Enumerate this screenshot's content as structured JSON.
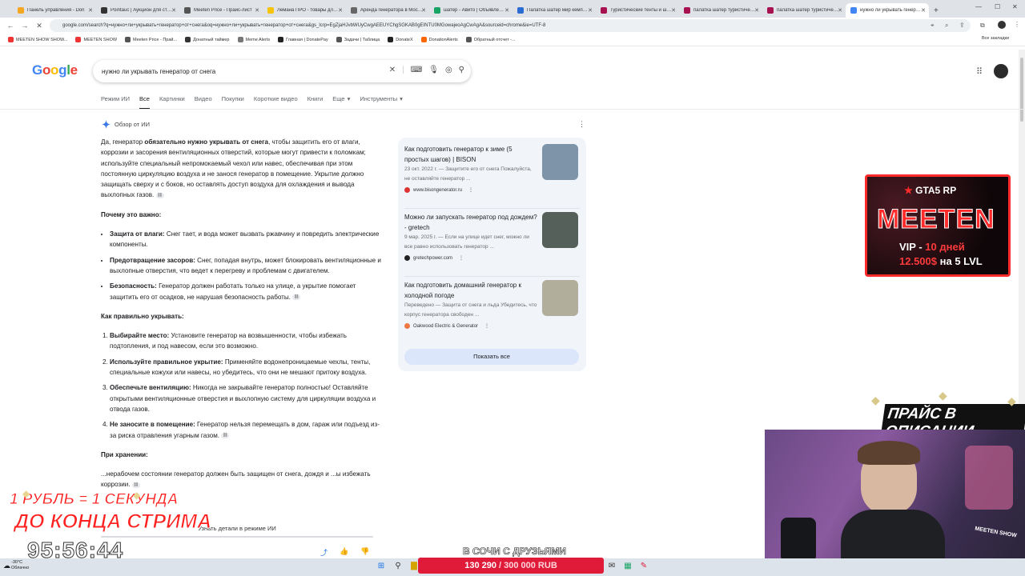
{
  "tabs": [
    {
      "title": "Панель управления - Don",
      "color": "#f5a623"
    },
    {
      "title": "Pointauc | Аукцион для стримеров",
      "color": "#333333"
    },
    {
      "title": "Meeten Price - Прайс-лист",
      "color": "#555555"
    },
    {
      "title": "Лемана ПРО - товары для дома",
      "color": "#f6c20a"
    },
    {
      "title": "Аренда генератора в Москве",
      "color": "#666666"
    },
    {
      "title": "шатер - Авито | Объявления",
      "color": "#19a463"
    },
    {
      "title": "Палатка шатер мир кемпинга",
      "color": "#2b6cd3"
    },
    {
      "title": "Туристические тенты и шатры",
      "color": "#a8114f"
    },
    {
      "title": "палатка шатер туристическая",
      "color": "#a8114f"
    },
    {
      "title": "палатка шатер туристическая",
      "color": "#a8114f"
    },
    {
      "title": "нужно ли укрывать генератор от снега",
      "color": "#4285f4",
      "active": true
    }
  ],
  "url": "google.com/search?q=нужно+ли+укрывать+генератор+от+снега&oq=нужно+ли+укрывать+генератор+от+снега&gs_lcrp=EgZjaHJvbWUyCwgAEEUYChgSGKAB0gEINTU0MGowajeoAgCwAgA&sourceid=chrome&ie=UTF-8",
  "bookmarks": [
    "MEETEN SHOW SHOW...",
    "MEETEN SHOW",
    "Meeten Price - Прай...",
    "Донатный таймер",
    "Meme Alerts",
    "Главная | DonatePay",
    "Задачи | Таблица",
    "DonateX",
    "DonationAlerts",
    "Обратный отсчет -..."
  ],
  "bookmarks_all": "Все закладки",
  "search": {
    "query": "нужно ли укрывать генератор от снега"
  },
  "logo": "Google",
  "search_tabs": [
    "Режим ИИ",
    "Все",
    "Картинки",
    "Видео",
    "Покупки",
    "Короткие видео",
    "Книги",
    "Еще",
    "Инструменты"
  ],
  "ai": {
    "header": "Обзор от ИИ",
    "intro_pre": "Да, генератор ",
    "intro_bold": "обязательно нужно укрывать от снега",
    "intro_post": ", чтобы защитить его от влаги, коррозии и засорения вентиляционных отверстий, которые могут привести к поломкам; используйте специальный непромокаемый чехол или навес, обеспечивая при этом постоянную циркуляцию воздуха и не занося генератор в помещение. Укрытие должно защищать сверху и с боков, но оставлять доступ воздуха для охлаждения и вывода выхлопных газов.",
    "why_title": "Почему это важно:",
    "why": [
      {
        "b": "Защита от влаги:",
        "t": " Снег тает, и вода может вызвать ржавчину и повредить электрические компоненты."
      },
      {
        "b": "Предотвращение засоров:",
        "t": " Снег, попадая внутрь, может блокировать вентиляционные и выхлопные отверстия, что ведет к перегреву и проблемам с двигателем."
      },
      {
        "b": "Безопасность:",
        "t": " Генератор должен работать только на улице, а укрытие помогает защитить его от осадков, не нарушая безопасность работы."
      }
    ],
    "how_title": "Как правильно укрывать:",
    "how": [
      {
        "b": "Выбирайте место:",
        "t": " Установите генератор на возвышенности, чтобы избежать подтопления, и под навесом, если это возможно."
      },
      {
        "b": "Используйте правильное укрытие:",
        "t": " Применяйте водонепроницаемые чехлы, тенты, специальные кожухи или навесы, но убедитесь, что они не мешают притоку воздуха."
      },
      {
        "b": "Обеспечьте вентиляцию:",
        "t": " Никогда не закрывайте генератор полностью! Оставляйте открытыми вентиляционные отверстия и выхлопную систему для циркуляции воздуха и отвода газов."
      },
      {
        "b": "Не заносите в помещение:",
        "t": " Генератор нельзя перемещать в дом, гараж или подъезд из-за риска отравления угарным газом."
      }
    ],
    "storage_title": "При хранении:",
    "storage_text": "...нерабочем состоянии генератор должен быть защищен от снега, дождя и ...ы избежать коррозии.",
    "more": "Узнать детали в режиме ИИ"
  },
  "sources": [
    {
      "title": "Как подготовить генератор к зиме (5 простых шагов) | BISON",
      "snippet": "23 окт. 2022 г. — Защитите его от снега Пожалуйста, не оставляйте генератор ...",
      "site": "www.bisongenerator.ru",
      "thumb": "#7e94a8"
    },
    {
      "title": "Можно ли запускать генератор под дождем? - gretech",
      "snippet": "9 мар. 2025 г. — Если на улице идет снег, можно ли все равно использовать генератор ...",
      "site": "gretechpower.com",
      "thumb": "#55605a"
    },
    {
      "title": "Как подготовить домашний генератор к холодной погоде",
      "snippet": "Переведено — Защита от снега и льда Убедитесь, что корпус генератора свободен ...",
      "site": "Oakwood Electric & Generator",
      "thumb": "#b2ae9c"
    }
  ],
  "show_all": "Показать все",
  "overlay": {
    "ad_brand": "GTA5 RP",
    "ad_name": "MEETEN",
    "ad_line1_a": "VIP -",
    "ad_line1_b": "10 дней",
    "ad_line2_a": "12.500$",
    "ad_line2_b": "на 5 LVL",
    "banner": "ПРАЙС В ОПИСАНИИ",
    "promo1": "1 РУБЛЬ = 1 СЕКУНДА",
    "promo2": "ДО КОНЦА СТРИМА",
    "timer": "95:56:44",
    "sochi": "В СОЧИ С ДРУЗЬЯМИ",
    "goal_current": "130 290",
    "goal_total": "/ 300 000 RUB",
    "cam_label": "MEETEN SHOW"
  },
  "weather": {
    "temp": "-30°C",
    "desc": "Облачно"
  }
}
